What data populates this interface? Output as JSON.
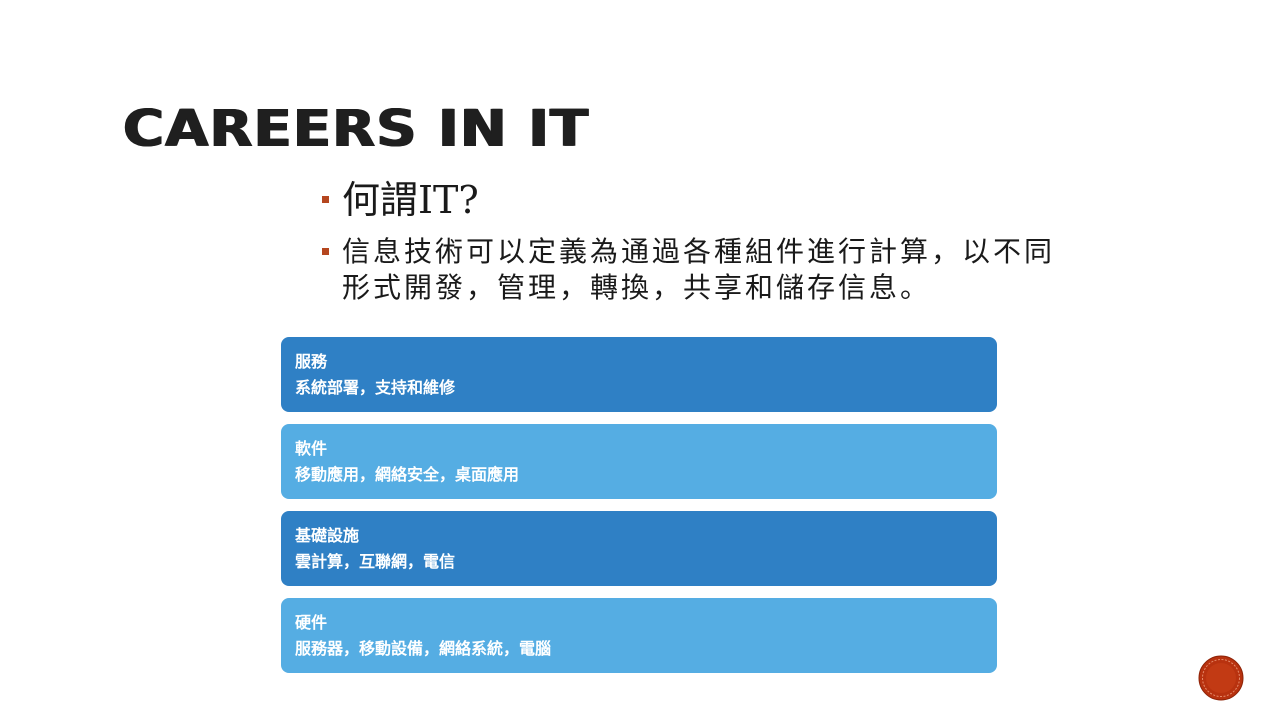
{
  "slide": {
    "title": "Careers in IT",
    "bullets": [
      {
        "text": "何謂IT?"
      },
      {
        "text": "信息技術可以定義為通過各種組件進行計算，以不同形式開發，管理，轉換，共享和儲存信息。"
      }
    ],
    "blocks": [
      {
        "heading": "服務",
        "detail": "系統部署，支持和維修",
        "color": "#2f80c5"
      },
      {
        "heading": "軟件",
        "detail": "移動應用，網絡安全，桌面應用",
        "color": "#55ade3"
      },
      {
        "heading": "基礎設施",
        "detail": "雲計算，互聯網，電信",
        "color": "#2f80c5"
      },
      {
        "heading": "硬件",
        "detail": "服務器，移動設備，網絡系統，電腦",
        "color": "#55ade3"
      }
    ],
    "colors": {
      "bullet_marker": "#b5461f",
      "logo": "#b8320f"
    },
    "logo_icon": "red-circle-logo-icon"
  }
}
